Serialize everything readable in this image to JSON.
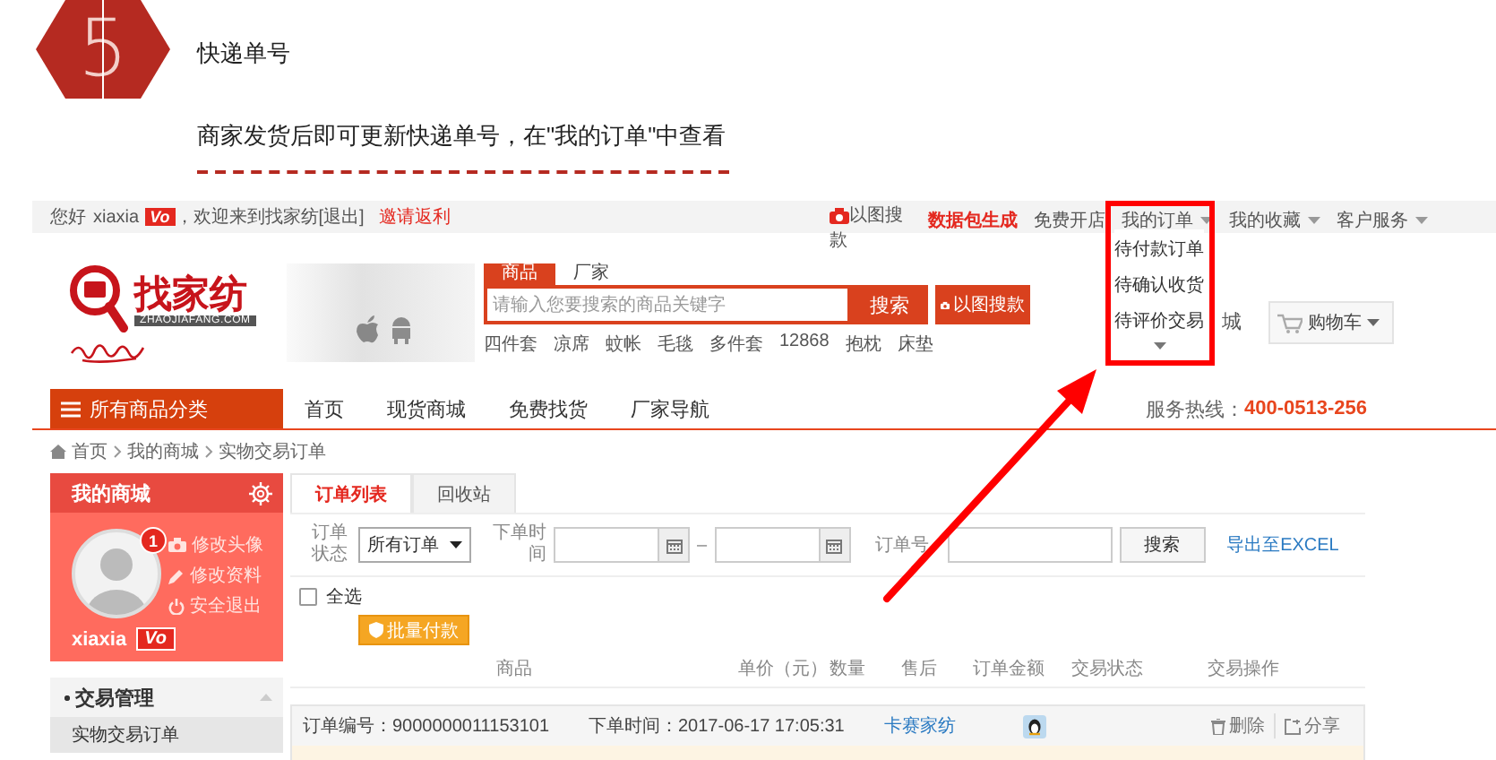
{
  "step": {
    "number": "5",
    "title": "快递单号",
    "description": "商家发货后即可更新快递单号，在\"我的订单\"中查看"
  },
  "topbar": {
    "greeting": "您好",
    "username": "xiaxia",
    "vip_badge": "Vo",
    "welcome": "，欢迎来到找家纺",
    "logout": "[退出]",
    "invite": "邀请返利",
    "links": [
      {
        "kind": "image-search",
        "label": "以图搜款"
      },
      {
        "kind": "highlight",
        "label": "数据包生成"
      },
      {
        "kind": "plain",
        "label": "免费开店"
      },
      {
        "kind": "menu",
        "label": "我的订单"
      },
      {
        "kind": "menu",
        "label": "我的收藏"
      },
      {
        "kind": "menu",
        "label": "客户服务"
      }
    ]
  },
  "order_menu": {
    "items": [
      "待付款订单",
      "待确认收货",
      "待评价交易"
    ]
  },
  "logo": {
    "name": "找家纺",
    "domain": "ZHAOJIAFANG.COM"
  },
  "search": {
    "tabs": [
      {
        "label": "商品",
        "selected": true
      },
      {
        "label": "厂家",
        "selected": false
      }
    ],
    "placeholder": "请输入您要搜索的商品关键字",
    "button": "搜索",
    "image_button": "以图搜款",
    "hot_words": [
      "四件套",
      "凉席",
      "蚊帐",
      "毛毯",
      "多件套",
      "12868",
      "抱枕",
      "床垫"
    ]
  },
  "mall_link": "城",
  "cart": "购物车",
  "nav": {
    "category_button": "所有商品分类",
    "items": [
      "首页",
      "现货商城",
      "免费找货",
      "厂家导航"
    ],
    "hotline_label": "服务热线：",
    "hotline": "400-0513-256"
  },
  "breadcrumb": [
    "首页",
    "我的商城",
    "实物交易订单"
  ],
  "sidebar": {
    "title": "我的商城",
    "notifications": "1",
    "links": [
      {
        "kind": "camera",
        "label": "修改头像"
      },
      {
        "kind": "pencil",
        "label": "修改资料"
      },
      {
        "kind": "power",
        "label": "安全退出"
      }
    ],
    "username": "xiaxia",
    "vip_badge": "Vo",
    "sections": [
      {
        "label": "交易管理",
        "expanded": true,
        "items": [
          {
            "label": "实物交易订单",
            "selected": true
          }
        ]
      }
    ]
  },
  "main": {
    "tabs": [
      {
        "label": "订单列表",
        "selected": true
      },
      {
        "label": "回收站",
        "selected": false
      }
    ],
    "filters": {
      "status_label": "订单状态",
      "status_value": "所有订单",
      "time_label": "下单时间",
      "date_separator": "–",
      "order_no_label": "订单号",
      "search_button": "搜索",
      "export_link": "导出至EXCEL"
    },
    "select_all": {
      "label": "全选",
      "checked": false
    },
    "batch_pay_button": "批量付款",
    "columns": [
      "商品",
      "单价（元）",
      "数量",
      "售后",
      "订单金额",
      "交易状态",
      "交易操作"
    ],
    "orders": [
      {
        "number": "订单编号：9000000011153101",
        "time": "下单时间：2017-06-17 17:05:31",
        "shop": "卡赛家纺",
        "actions": [
          "删除",
          "分享"
        ]
      }
    ]
  }
}
